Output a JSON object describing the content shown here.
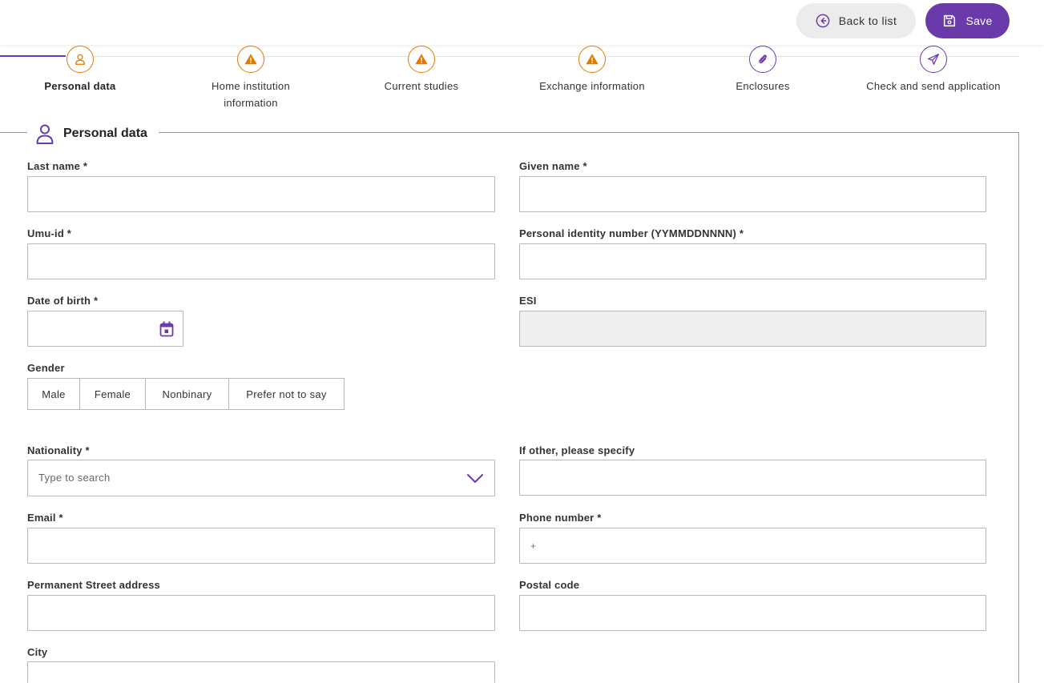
{
  "header": {
    "back_label": "Back to list",
    "save_label": "Save"
  },
  "colors": {
    "accent": "#6a3aaa",
    "warning": "#e07b00"
  },
  "steps": [
    {
      "label": "Personal data",
      "icon": "user-icon",
      "state": "active"
    },
    {
      "label": "Home institution information",
      "icon": "warning-icon",
      "state": "warning"
    },
    {
      "label": "Current studies",
      "icon": "warning-icon",
      "state": "warning"
    },
    {
      "label": "Exchange information",
      "icon": "warning-icon",
      "state": "warning"
    },
    {
      "label": "Enclosures",
      "icon": "paperclip-icon",
      "state": "default"
    },
    {
      "label": "Check and send application",
      "icon": "send-icon",
      "state": "default"
    }
  ],
  "section": {
    "title": "Personal data",
    "icon": "user-icon"
  },
  "form": {
    "last_name": {
      "label": "Last name *",
      "value": ""
    },
    "given_name": {
      "label": "Given name *",
      "value": ""
    },
    "umu_id": {
      "label": "Umu-id *",
      "value": ""
    },
    "personal_id": {
      "label": "Personal identity number (YYMMDDNNNN) *",
      "value": ""
    },
    "date_of_birth": {
      "label": "Date of birth *",
      "value": "",
      "icon": "calendar-icon"
    },
    "esi": {
      "label": "ESI",
      "value": "",
      "disabled": true
    },
    "gender": {
      "label": "Gender",
      "options": [
        "Male",
        "Female",
        "Nonbinary",
        "Prefer not to say"
      ]
    },
    "nationality": {
      "label": "Nationality *",
      "placeholder": "Type to search",
      "icon": "chevron-down-icon"
    },
    "other_nationality": {
      "label": "If other, please specify",
      "value": ""
    },
    "email": {
      "label": "Email *",
      "value": ""
    },
    "phone": {
      "label": "Phone number *",
      "placeholder": "+"
    },
    "street": {
      "label": "Permanent Street address",
      "value": ""
    },
    "postal_code": {
      "label": "Postal code",
      "value": ""
    },
    "city": {
      "label": "City",
      "value": ""
    }
  }
}
